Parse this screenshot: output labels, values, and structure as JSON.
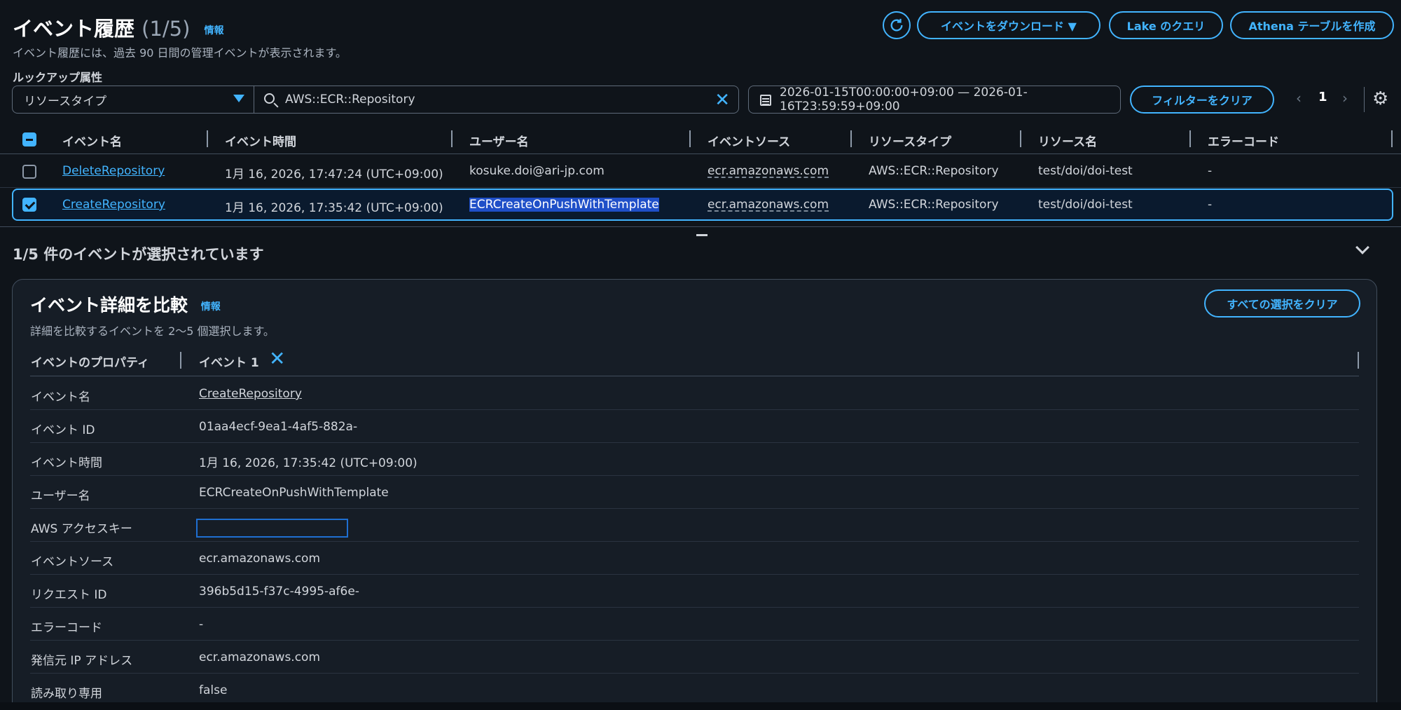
{
  "header": {
    "title": "イベント履歴",
    "count": "(1/5)",
    "info": "情報",
    "subtitle": "イベント履歴には、過去 90 日間の管理イベントが表示されます。",
    "buttons": {
      "download": "イベントをダウンロード ▼",
      "lake": "Lake のクエリ",
      "athena": "Athena テーブルを作成"
    }
  },
  "lookup": {
    "label": "ルックアップ属性",
    "attribute": "リソースタイプ",
    "search_value": "AWS::ECR::Repository",
    "date_range": "2026-01-15T00:00:00+09:00 — 2026-01-16T23:59:59+09:00",
    "clear_filters": "フィルターをクリア",
    "page": "1"
  },
  "table": {
    "columns": [
      "イベント名",
      "イベント時間",
      "ユーザー名",
      "イベントソース",
      "リソースタイプ",
      "リソース名",
      "エラーコード"
    ],
    "rows": [
      {
        "name": "DeleteRepository",
        "time": "1月 16, 2026, 17:47:24 (UTC+09:00)",
        "user": "kosuke.doi@ari-jp.com",
        "source": "ecr.amazonaws.com",
        "type": "AWS::ECR::Repository",
        "resource": "test/doi/doi-test",
        "error": "-"
      },
      {
        "name": "CreateRepository",
        "time": "1月 16, 2026, 17:35:42 (UTC+09:00)",
        "user": "ECRCreateOnPushWithTemplate",
        "source": "ecr.amazonaws.com",
        "type": "AWS::ECR::Repository",
        "resource": "test/doi/doi-test",
        "error": "-"
      }
    ]
  },
  "selection": {
    "summary": "1/5 件のイベントが選択されています"
  },
  "compare": {
    "title": "イベント詳細を比較",
    "info": "情報",
    "subtitle": "詳細を比較するイベントを 2〜5 個選択します。",
    "clear_all": "すべての選択をクリア",
    "col_property": "イベントのプロパティ",
    "col_event": "イベント 1",
    "props": [
      {
        "label": "イベント名",
        "value": "CreateRepository"
      },
      {
        "label": "イベント ID",
        "value": "01aa4ecf-9ea1-4af5-882a-"
      },
      {
        "label": "イベント時間",
        "value": "1月 16, 2026, 17:35:42 (UTC+09:00)"
      },
      {
        "label": "ユーザー名",
        "value": "ECRCreateOnPushWithTemplate"
      },
      {
        "label": "AWS アクセスキー",
        "value": ""
      },
      {
        "label": "イベントソース",
        "value": "ecr.amazonaws.com"
      },
      {
        "label": "リクエスト ID",
        "value": "396b5d15-f37c-4995-af6e-"
      },
      {
        "label": "エラーコード",
        "value": "-"
      },
      {
        "label": "発信元 IP アドレス",
        "value": "ecr.amazonaws.com"
      },
      {
        "label": "読み取り専用",
        "value": "false"
      }
    ]
  }
}
